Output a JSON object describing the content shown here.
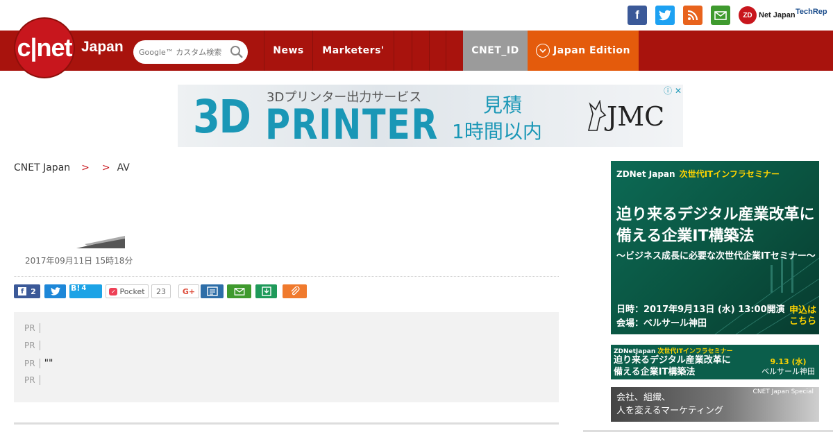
{
  "social": {
    "facebook": "f",
    "twitter": "t",
    "rss": "rss",
    "mail": "mail",
    "zdnet_badge": "ZD",
    "zdnet_label": "Net Japan",
    "techrep_label": "TechRep"
  },
  "header": {
    "logo_text": "c|net",
    "logo_region": "Japan",
    "search_placeholder": "Google™ カスタム検索",
    "nav": [
      "News",
      "Marketers'"
    ],
    "cnet_id": "CNET_ID",
    "edition": "Japan Edition"
  },
  "banner": {
    "sub": "3Dプリンター出力サービス",
    "big1": "3D",
    "big2": "PRINTER",
    "right1": "見積",
    "right2": "1時間以内",
    "brand": "JMC",
    "ad_close": "ⓘ ✕"
  },
  "breadcrumb": [
    "CNET Japan",
    "",
    "AV"
  ],
  "article": {
    "headline": "",
    "author": "",
    "date": "2017年09月11日 15時18分"
  },
  "share": {
    "facebook_count": "2",
    "hatena_label": "B!",
    "hatena_count": "4",
    "pocket_label": "Pocket",
    "pocket_count": "23",
    "gplus_label": "G+"
  },
  "pr": {
    "tag": "PR",
    "items": [
      "",
      "",
      "\"\"",
      ""
    ]
  },
  "sidebar": {
    "ad1": {
      "tag_left": "ZDNet Japan",
      "tag_right": "次世代ITインフラセミナー",
      "main_line1": "迫り来るデジタル産業改革に",
      "main_line2": "備える企業IT構築法",
      "sub": "〜ビジネス成長に必要な次世代企業ITセミナー〜",
      "date_line1": "日時：2017年9月13日 (水) 13:00開演",
      "date_line2": "会場：ベルサール神田",
      "cta_line1": "申込は",
      "cta_line2": "こちら"
    },
    "ad2": {
      "tag_left": "ZDNetJapan",
      "tag_right": "次世代ITインフラセミナー",
      "main_line1": "迫り来るデジタル産業改革に",
      "main_line2": "備える企業IT構築法",
      "date": "9.13 (水)",
      "venue": "ベルサール神田"
    },
    "ad3": {
      "tag": "CNET Japan Special",
      "line1": "会社、組織、",
      "line2": "人を変えるマーケティング"
    }
  },
  "colors": {
    "nav_red": "#a8130d",
    "edition_orange": "#e45b0c",
    "cnet_id_gray": "#9b9b9b",
    "facebook": "#3b5998",
    "twitter": "#1da1f2",
    "rss": "#e8631d",
    "mail": "#3f9a2e"
  }
}
